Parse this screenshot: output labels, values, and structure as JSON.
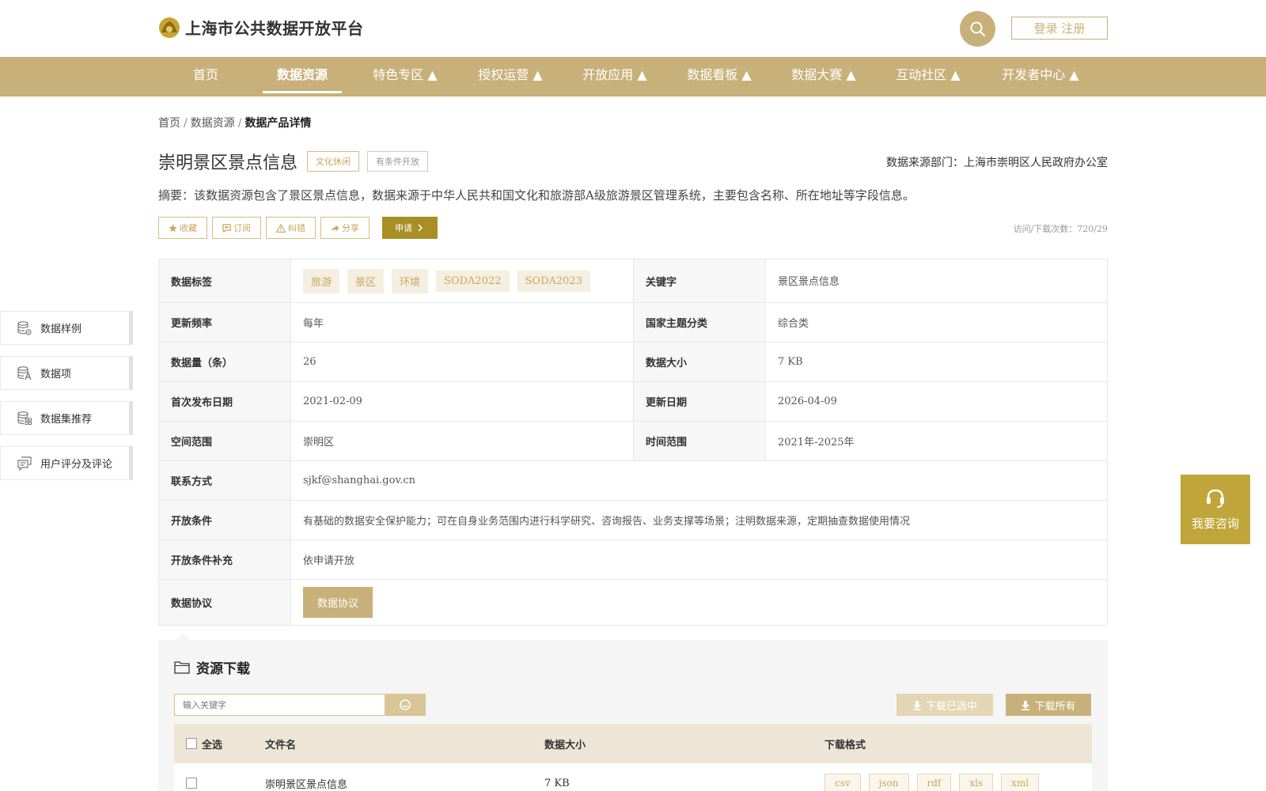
{
  "header": {
    "site_title": "上海市公共数据开放平台",
    "login_label": "登录 注册"
  },
  "nav": {
    "items": [
      {
        "label": "首页"
      },
      {
        "label": "数据资源"
      },
      {
        "label": "特色专区 ▲"
      },
      {
        "label": "授权运营 ▲"
      },
      {
        "label": "开放应用 ▲"
      },
      {
        "label": "数据看板 ▲"
      },
      {
        "label": "数据大赛 ▲"
      },
      {
        "label": "互动社区 ▲"
      },
      {
        "label": "开发者中心 ▲"
      }
    ],
    "active_index": 1
  },
  "breadcrumb": {
    "home": "首页",
    "resources": "数据资源",
    "current": "数据产品详情",
    "separator": "/"
  },
  "dataset": {
    "title": "崇明景区景点信息",
    "category_tag": "文化休闲",
    "open_tag": "有条件开放",
    "source_dept": "数据来源部门：上海市崇明区人民政府办公室",
    "summary": "摘要：该数据资源包含了景区景点信息，数据来源于中华人民共和国文化和旅游部A级旅游景区管理系统，主要包含名称、所在地址等字段信息。",
    "visits": "访问/下载次数：720/29"
  },
  "actions": {
    "favorite": "收藏",
    "subscribe": "订阅",
    "report": "纠错",
    "share": "分享",
    "apply": "申请"
  },
  "info": {
    "tags_label": "数据标签",
    "tags": [
      "旅游",
      "景区",
      "环境",
      "SODA2022",
      "SODA2023"
    ],
    "keyword_label": "关键字",
    "keyword": "景区景点信息",
    "freq_label": "更新频率",
    "freq": "每年",
    "theme_label": "国家主题分类",
    "theme": "综合类",
    "count_label": "数据量（条）",
    "count": "26",
    "size_label": "数据大小",
    "size": "7 KB",
    "first_pub_label": "首次发布日期",
    "first_pub": "2021-02-09",
    "update_label": "更新日期",
    "update": "2026-04-09",
    "space_label": "空间范围",
    "space": "崇明区",
    "time_label": "时间范围",
    "time": "2021年-2025年",
    "contact_label": "联系方式",
    "contact": "sjkf@shanghai.gov.cn",
    "condition_label": "开放条件",
    "condition": "有基础的数据安全保护能力；可在自身业务范围内进行科学研究、咨询报告、业务支撑等场景；注明数据来源，定期抽查数据使用情况",
    "condition_extra_label": "开放条件补充",
    "condition_extra": "依申请开放",
    "agreement_label": "数据协议",
    "agreement_button": "数据协议"
  },
  "side_menu": {
    "items": [
      {
        "label": "数据样例",
        "icon": "database-gear-icon"
      },
      {
        "label": "数据项",
        "icon": "database-text-icon"
      },
      {
        "label": "数据集推荐",
        "icon": "database-grid-icon"
      },
      {
        "label": "用户评分及评论",
        "icon": "comment-icon"
      }
    ]
  },
  "consult": {
    "label": "我要咨询"
  },
  "download": {
    "title": "资源下载",
    "search_placeholder": "输入关键字",
    "download_selected": "下载已选中",
    "download_all": "下载所有",
    "columns": {
      "select_all": "全选",
      "file_name": "文件名",
      "size": "数据大小",
      "format": "下载格式"
    },
    "rows": [
      {
        "name": "崇明景区景点信息",
        "size": "7 KB",
        "formats": [
          "csv",
          "json",
          "rdf",
          "xls",
          "xml"
        ]
      }
    ]
  },
  "colors": {
    "brand_gold": "#c8b07a",
    "apply_olive": "#a88f24",
    "consult_gold": "#c0a53a"
  }
}
